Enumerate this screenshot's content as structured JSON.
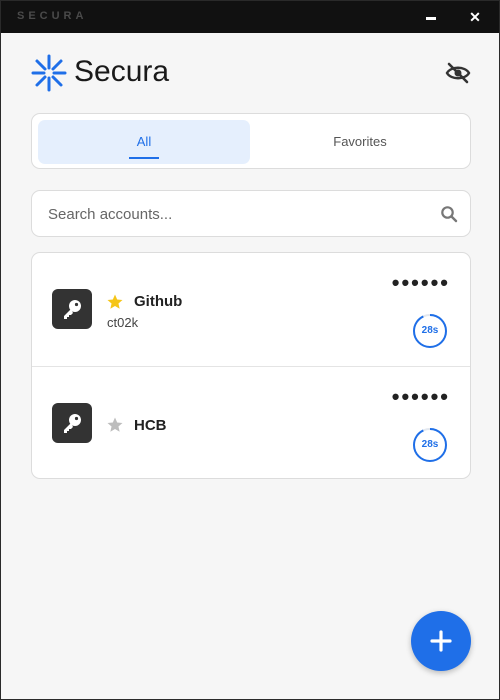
{
  "window": {
    "app_name": "SECURA",
    "minimize_icon": "minimize-icon",
    "close_label": "✕"
  },
  "header": {
    "brand": "Secura",
    "logo_icon": "asterisk-logo-icon",
    "visibility_toggle_icon": "eye-slash-icon"
  },
  "tabs": [
    {
      "label": "All",
      "active": true
    },
    {
      "label": "Favorites",
      "active": false
    }
  ],
  "search": {
    "placeholder": "Search accounts...",
    "value": ""
  },
  "accounts": [
    {
      "name": "Github",
      "username": "ct02k",
      "favorite": true,
      "code_masked": "••••••",
      "timer": "28s",
      "timer_fraction": 0.93
    },
    {
      "name": "HCB",
      "username": "",
      "favorite": false,
      "code_masked": "••••••",
      "timer": "28s",
      "timer_fraction": 0.93
    }
  ],
  "fab": {
    "icon": "plus-icon"
  },
  "colors": {
    "accent": "#1f6fe8",
    "favorite_star": "#f5c518",
    "unfavorite_star": "#bdbdbd",
    "key_tile": "#333333"
  }
}
